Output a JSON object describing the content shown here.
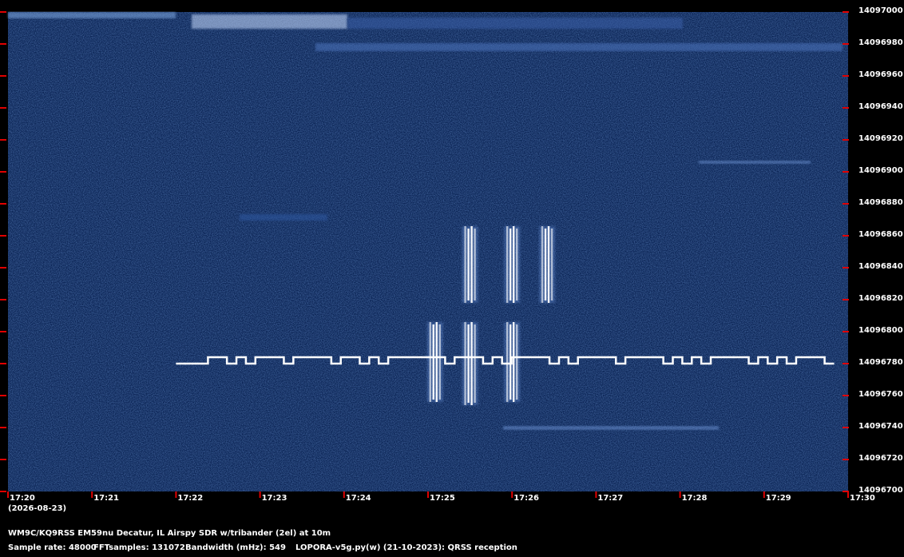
{
  "chart_data": {
    "type": "heatmap",
    "date_label": "(2026-08-23)",
    "x": {
      "ticks": [
        "17:20",
        "17:21",
        "17:22",
        "17:23",
        "17:24",
        "17:25",
        "17:26",
        "17:27",
        "17:28",
        "17:29",
        "17:30"
      ],
      "range": [
        "17:20",
        "17:30"
      ]
    },
    "y": {
      "ticks": [
        14097000,
        14096980,
        14096960,
        14096940,
        14096920,
        14096900,
        14096880,
        14096860,
        14096840,
        14096820,
        14096800,
        14096780,
        14096760,
        14096740,
        14096720,
        14096700
      ],
      "range": [
        14096700,
        14097000
      ]
    },
    "colors": {
      "background": "#0b2455",
      "signal": "#ffffff",
      "tick": "#e00000",
      "axis_text": "#ffffff"
    },
    "reference_trace": {
      "baseline": 14096780,
      "high": 14096784,
      "start": "17:22",
      "end": "17:29:50"
    },
    "signal_bursts": [
      {
        "time": "17:25:30",
        "freq_min": 14096818,
        "freq_max": 14096866
      },
      {
        "time": "17:26:00",
        "freq_min": 14096818,
        "freq_max": 14096866
      },
      {
        "time": "17:26:25",
        "freq_min": 14096818,
        "freq_max": 14096866
      },
      {
        "time": "17:25:05",
        "freq_min": 14096756,
        "freq_max": 14096806
      },
      {
        "time": "17:25:30",
        "freq_min": 14096754,
        "freq_max": 14096806
      },
      {
        "time": "17:26:00",
        "freq_min": 14096756,
        "freq_max": 14096806
      }
    ]
  },
  "footer": {
    "station": "WM9C/KQ9RSS EM59nu Decatur, IL  Airspy SDR w/tribander (2el) at 10m",
    "sample_rate": "Sample rate: 48000",
    "fft_samples": "FFTsamples: 131072",
    "bandwidth": "Bandwidth (mHz): 549",
    "software": "LOPORA-v5g.py(w) (21-10-2023): QRSS reception"
  }
}
